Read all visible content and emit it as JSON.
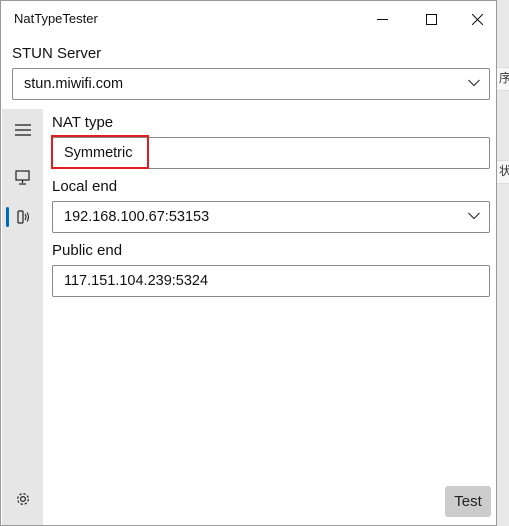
{
  "window": {
    "title": "NatTypeTester",
    "controls": [
      "minimize",
      "maximize",
      "close"
    ]
  },
  "stun": {
    "label": "STUN Server",
    "value": "stun.miwifi.com"
  },
  "sidebar": {
    "items": [
      {
        "icon": "hamburger-menu-icon"
      },
      {
        "icon": "monitor-icon"
      },
      {
        "icon": "network-transmit-icon",
        "selected": true
      },
      {
        "icon": "gear-icon"
      }
    ]
  },
  "nat": {
    "label": "NAT type",
    "value": "Symmetric"
  },
  "local": {
    "label": "Local end",
    "value": "192.168.100.67:53153"
  },
  "public": {
    "label": "Public end",
    "value": "117.151.104.239:5324"
  },
  "actions": {
    "test_label": "Test"
  },
  "background_glimpse": {
    "chars": [
      "序",
      "状"
    ]
  },
  "colors": {
    "accent": "#0067c0",
    "highlight_box": "#e02020"
  }
}
